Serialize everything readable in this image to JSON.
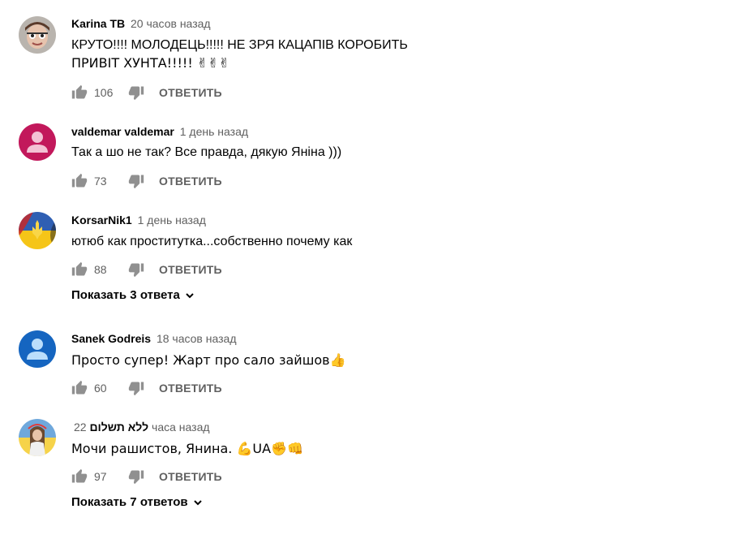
{
  "comments": [
    {
      "author": "Karina TB",
      "time": "20 часов назад",
      "text_lines": [
        "КРУТО!!!! МОЛОДЕЦЬ!!!!! НЕ ЗРЯ КАЦАПІВ КОРОБИТЬ",
        "ПРИВІТ ХУНТА!!!!! ✌✌✌"
      ],
      "likes": "106",
      "reply_label": "ОТВЕТИТЬ"
    },
    {
      "author": "valdemar valdemar",
      "time": "1 день назад",
      "text_lines": [
        "Так а шо не так?  Все правда, дякую Яніна )))"
      ],
      "likes": "73",
      "reply_label": "ОТВЕТИТЬ",
      "avatar_color": "#c2185b"
    },
    {
      "author": "KorsarNik1",
      "time": "1 день назад",
      "text_lines": [
        "ютюб как проститутка...собственно почему как"
      ],
      "likes": "88",
      "reply_label": "ОТВЕТИТЬ",
      "replies_label": "Показать 3 ответа"
    },
    {
      "author": "Sanek Godreis",
      "time": "18 часов назад",
      "text_lines": [
        "Просто супер! Жарт про сало зайшов👍"
      ],
      "likes": "60",
      "reply_label": "ОТВЕТИТЬ",
      "avatar_color": "#1565c0"
    },
    {
      "author": "ללא תשלום",
      "time": "22 часа назад",
      "text_lines": [
        "Мочи рашистов, Янина. 💪UA✊👊"
      ],
      "likes": "97",
      "reply_label": "ОТВЕТИТЬ",
      "replies_label": "Показать 7 ответов"
    }
  ],
  "colors": {
    "author": "#030303",
    "meta": "#606060",
    "icon": "#909090"
  },
  "icons": [
    "thumb-up-icon",
    "thumb-down-icon",
    "chevron-down-icon",
    "person-icon"
  ]
}
